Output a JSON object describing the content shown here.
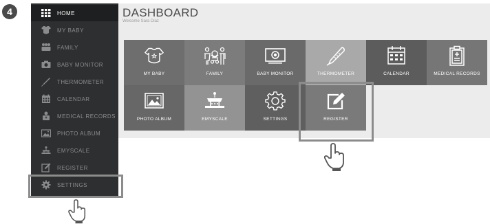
{
  "step_number": "4",
  "sidebar": {
    "items": [
      {
        "label": "HOME",
        "icon": "grid-icon",
        "active": true
      },
      {
        "label": "MY BABY",
        "icon": "onesie-icon"
      },
      {
        "label": "FAMILY",
        "icon": "people-icon"
      },
      {
        "label": "BABY MONITOR",
        "icon": "camera-icon"
      },
      {
        "label": "THERMOMETER",
        "icon": "thermometer-icon"
      },
      {
        "label": "CALENDAR",
        "icon": "calendar-icon"
      },
      {
        "label": "MEDICAL RECORDS",
        "icon": "medical-records-icon"
      },
      {
        "label": "PHOTO ALBUM",
        "icon": "photo-icon"
      },
      {
        "label": "EMYSCALE",
        "icon": "scale-icon"
      },
      {
        "label": "REGISTER",
        "icon": "edit-icon"
      },
      {
        "label": "SETTINGS",
        "icon": "gear-icon"
      }
    ]
  },
  "dashboard": {
    "title": "DASHBOARD",
    "welcome": "Welcome Sara Diaz"
  },
  "tiles": [
    {
      "label": "MY BABY",
      "icon": "onesie-icon",
      "color": "#6e6e6e"
    },
    {
      "label": "FAMILY",
      "icon": "family-icon",
      "color": "#7c7c7c"
    },
    {
      "label": "BABY MONITOR",
      "icon": "monitor-icon",
      "color": "#6a6a6a"
    },
    {
      "label": "THERMOMETER",
      "icon": "thermometer-icon",
      "color": "#a9a9a9"
    },
    {
      "label": "CALENDAR",
      "icon": "calendar-icon",
      "color": "#5c5c5c"
    },
    {
      "label": "MEDICAL RECORDS",
      "icon": "medical-records-icon",
      "color": "#767676"
    },
    {
      "label": "PHOTO ALBUM",
      "icon": "photo-icon",
      "color": "#676767"
    },
    {
      "label": "EMYSCALE",
      "icon": "scale-icon",
      "color": "#939393"
    },
    {
      "label": "SETTINGS",
      "icon": "gear-icon",
      "color": "#5f5f5f"
    },
    {
      "label": "REGISTER",
      "icon": "edit-icon",
      "color": "#7a7a7a"
    }
  ]
}
